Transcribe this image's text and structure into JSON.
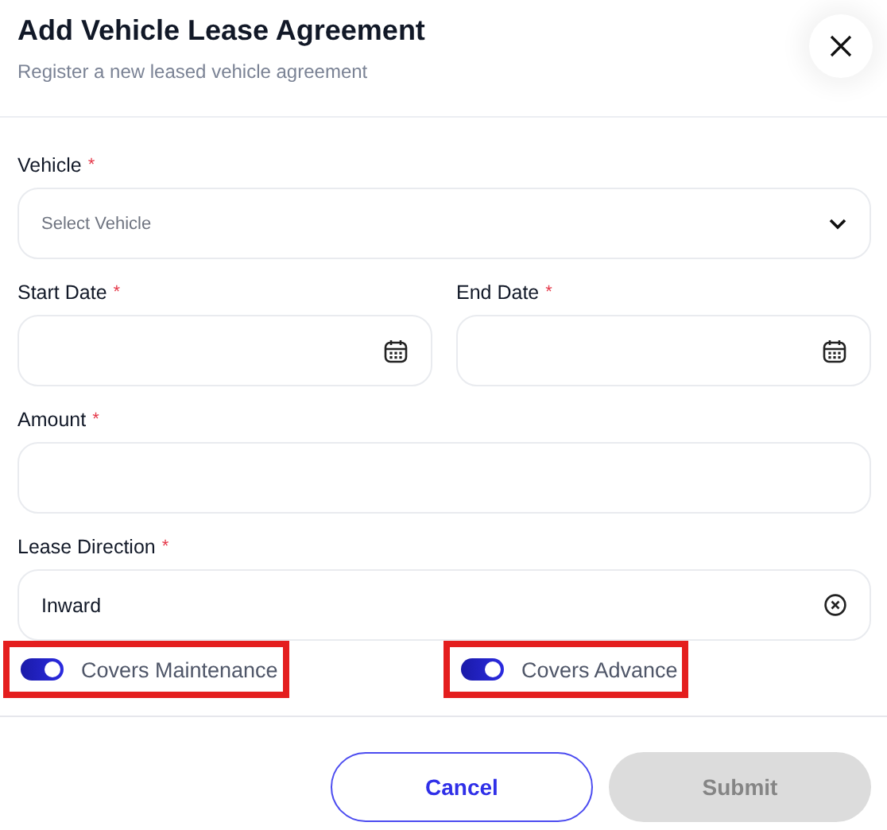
{
  "header": {
    "title": "Add Vehicle Lease Agreement",
    "subtitle": "Register a new leased vehicle agreement"
  },
  "rows": [
    [
      {
        "kind": "select",
        "label": "Vehicle",
        "required_mark": "*",
        "placeholder": "Select Vehicle"
      }
    ],
    [
      {
        "kind": "date",
        "label": "Start Date",
        "required_mark": "*"
      },
      {
        "kind": "date",
        "label": "End Date",
        "required_mark": "*"
      }
    ],
    [
      {
        "kind": "text",
        "label": "Amount",
        "required_mark": "*"
      }
    ],
    [
      {
        "kind": "clearable",
        "label": "Lease Direction",
        "required_mark": "*",
        "value": "Inward"
      }
    ]
  ],
  "toggles": [
    {
      "label": "Covers Maintenance",
      "on": true,
      "highlighted": true
    },
    {
      "label": "Covers Advance",
      "on": true,
      "highlighted": true
    }
  ],
  "buttons": [
    {
      "label": "Cancel",
      "kind": "outline",
      "disabled": false
    },
    {
      "label": "Submit",
      "kind": "primary",
      "disabled": true
    }
  ]
}
